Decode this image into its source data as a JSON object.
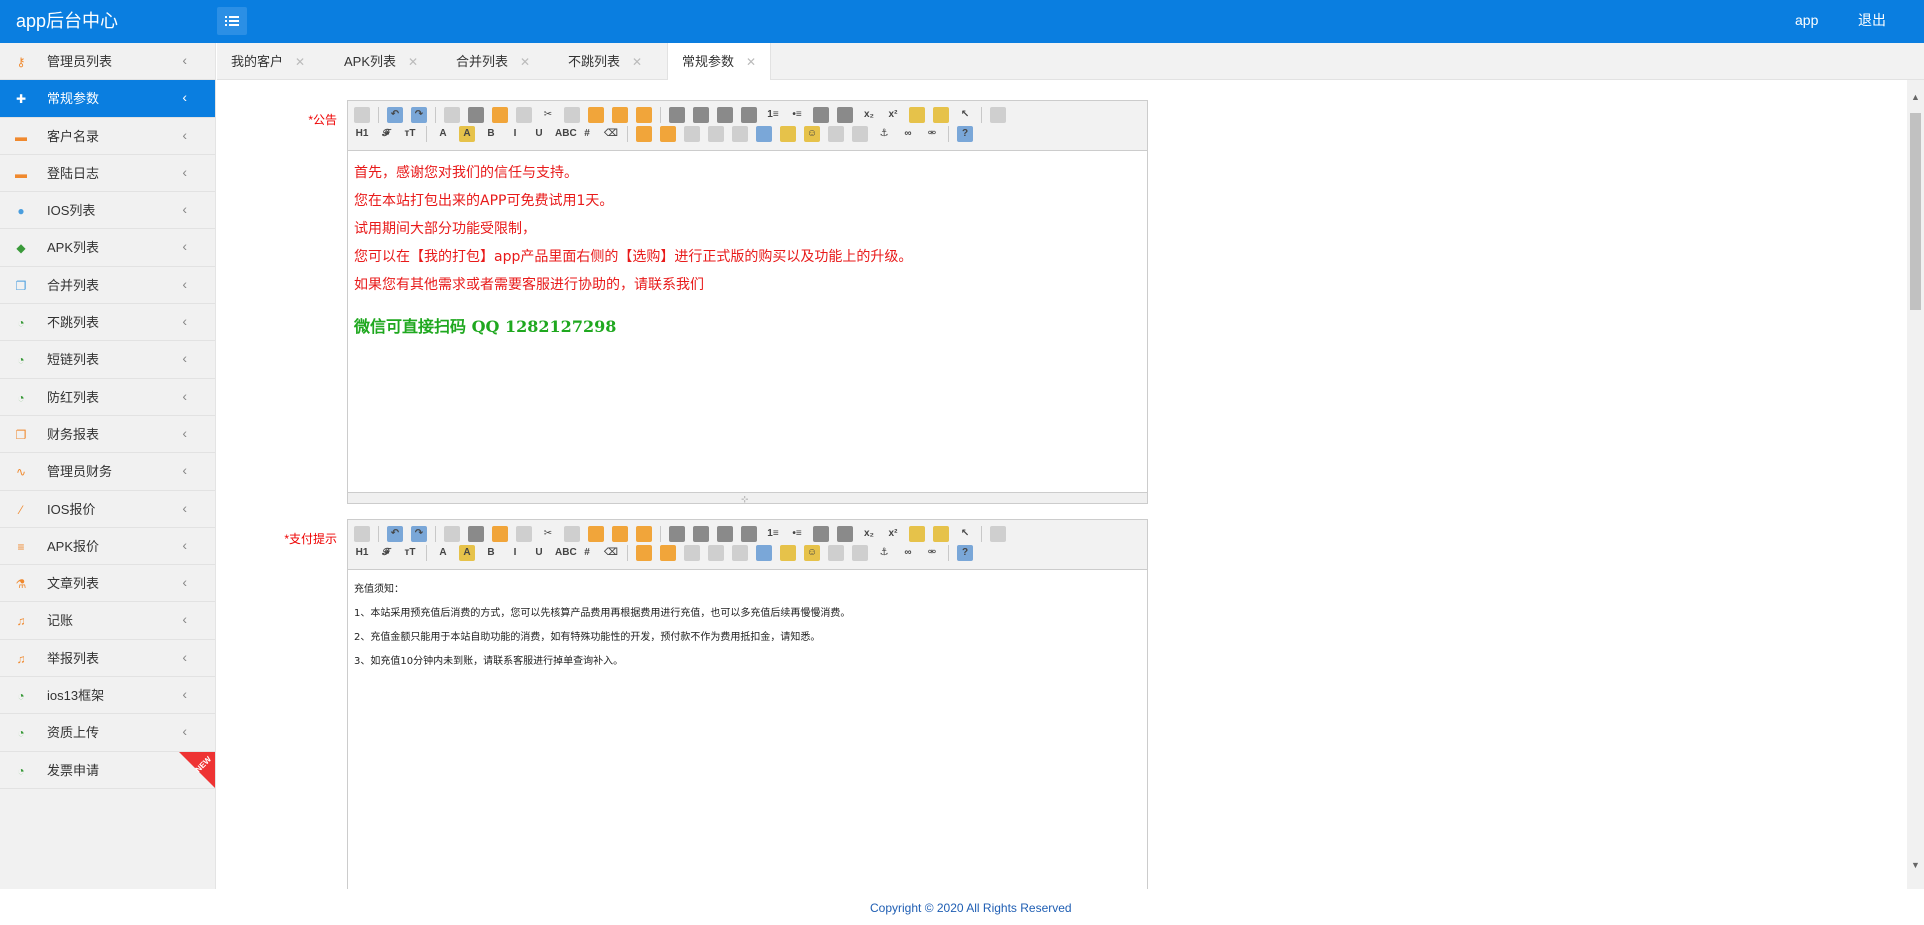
{
  "header": {
    "logo": "app后台中心",
    "user": "app",
    "logout": "退出"
  },
  "sidebar": {
    "items": [
      {
        "label": "管理员列表",
        "icon": "key-icon",
        "color": "#f0892e"
      },
      {
        "label": "常规参数",
        "icon": "plus-icon",
        "color": "#f0892e"
      },
      {
        "label": "客户名录",
        "icon": "briefcase-icon",
        "color": "#f0892e"
      },
      {
        "label": "登陆日志",
        "icon": "briefcase-icon",
        "color": "#f0892e"
      },
      {
        "label": "IOS列表",
        "icon": "apple-icon",
        "color": "#4a9ede"
      },
      {
        "label": "APK列表",
        "icon": "android-icon",
        "color": "#3a9a3a"
      },
      {
        "label": "合并列表",
        "icon": "copy-icon",
        "color": "#4a9ede"
      },
      {
        "label": "不跳列表",
        "icon": "rss-icon",
        "color": "#3a9a3a"
      },
      {
        "label": "短链列表",
        "icon": "rss-icon",
        "color": "#3a9a3a"
      },
      {
        "label": "防红列表",
        "icon": "rss-icon",
        "color": "#3a9a3a"
      },
      {
        "label": "财务报表",
        "icon": "copy-icon",
        "color": "#f0892e"
      },
      {
        "label": "管理员财务",
        "icon": "stethoscope-icon",
        "color": "#f0892e"
      },
      {
        "label": "IOS报价",
        "icon": "wand-icon",
        "color": "#f0892e"
      },
      {
        "label": "APK报价",
        "icon": "list-icon",
        "color": "#f0892e"
      },
      {
        "label": "文章列表",
        "icon": "flask-icon",
        "color": "#f0892e"
      },
      {
        "label": "记账",
        "icon": "music-icon",
        "color": "#f0892e"
      },
      {
        "label": "举报列表",
        "icon": "music-icon",
        "color": "#f0892e"
      },
      {
        "label": "ios13框架",
        "icon": "rss-icon",
        "color": "#3a9a3a"
      },
      {
        "label": "资质上传",
        "icon": "rss-icon",
        "color": "#3a9a3a"
      },
      {
        "label": "发票申请",
        "icon": "rss-icon",
        "color": "#3a9a3a"
      }
    ],
    "new_badge": "NEW"
  },
  "tabs": [
    {
      "label": "我的客户"
    },
    {
      "label": "APK列表"
    },
    {
      "label": "合并列表"
    },
    {
      "label": "不跳列表"
    },
    {
      "label": "常规参数"
    }
  ],
  "form": {
    "announcement_label": "*公告",
    "announcement_lines": [
      "首先，感谢您对我们的信任与支持。",
      "您在本站打包出来的APP可免费试用1天。",
      "试用期间大部分功能受限制，",
      "您可以在【我的打包】app产品里面右侧的【选购】进行正式版的购买以及功能上的升级。",
      "如果您有其他需求或者需要客服进行协助的，请联系我们"
    ],
    "announcement_highlight": "微信可直接扫码  QQ 1282127298",
    "payment_label": "*支付提示",
    "payment_lines": [
      "充值须知：",
      "1、本站采用预充值后消费的方式，您可以先核算产品费用再根据费用进行充值，也可以多充值后续再慢慢消费。",
      "2、充值金额只能用于本站自助功能的消费，如有特殊功能性的开发，预付款不作为费用抵扣金，请知悉。",
      "3、如充值10分钟内未到账，请联系客服进行掉单查询补入。"
    ]
  },
  "footer": {
    "copyright": "Copyright © 2020 All Rights Reserved"
  },
  "colors": {
    "primary": "#0a7ee0",
    "required_label": "#e00000",
    "announcement_text": "#e81a1a",
    "announcement_highlight": "#1fa81f"
  }
}
